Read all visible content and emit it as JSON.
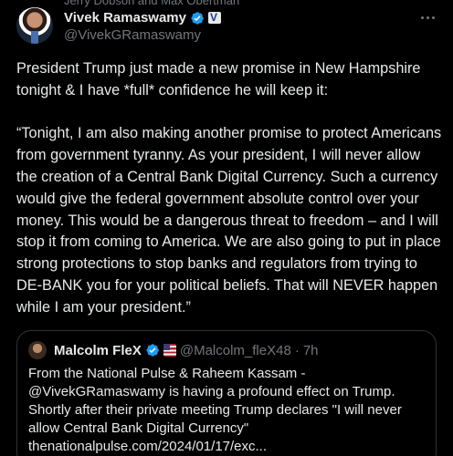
{
  "social_context": "Jerry Dobson and Max Obertman",
  "post": {
    "author": {
      "display_name": "Vivek Ramaswamy",
      "handle": "@VivekGRamaswamy",
      "verified": true,
      "affiliation_badge": "flag-icon"
    },
    "body": "President Trump just made a new promise in New Hampshire tonight & I have *full* confidence he will keep it:\n\n“Tonight, I am also making another promise to protect Americans from government tyranny. As your president, I will never allow the creation of a Central Bank Digital Currency. Such a currency would give the federal government absolute control over your money. This would be a dangerous threat to freedom – and I will stop it from coming to America. We are also going to put in place strong protections to stop banks and regulators from trying to DE-BANK you for your political beliefs. That will NEVER happen while I am your president.”"
  },
  "quote": {
    "author": {
      "display_name": "Malcolm FleX",
      "handle": "@Malcolm_fleX48",
      "verified": true
    },
    "separator": "·",
    "timestamp": "7h",
    "body": "From the National Pulse & Raheem Kassam - @VivekGRamaswamy is having a profound effect on Trump. Shortly after their private meeting Trump declares \"I will never allow Central Bank Digital Currency\"\n thenationalpulse.com/2024/01/17/exc..."
  },
  "colors": {
    "background": "#000000",
    "text_primary": "#e7e9ea",
    "text_secondary": "#71767b",
    "verified_blue": "#1d9bf0",
    "border": "#2f3336"
  }
}
